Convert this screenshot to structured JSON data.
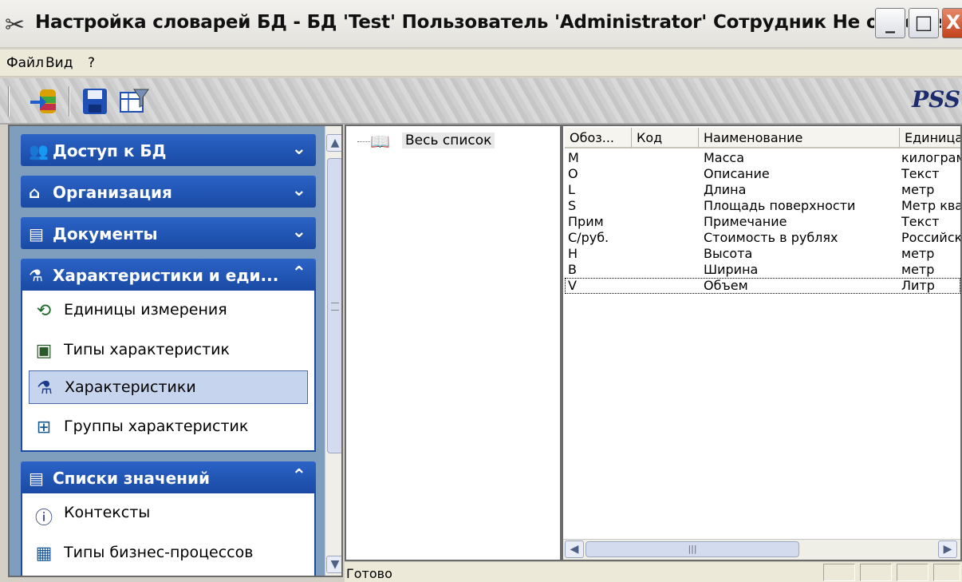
{
  "window": {
    "title": "Настройка словарей БД - БД 'Test' Пользователь 'Administrator' Сотрудник Не определен",
    "min_glyph": "_",
    "max_glyph": "□",
    "close_glyph": "X"
  },
  "menu": {
    "items": [
      "Файл",
      "Вид",
      "?"
    ]
  },
  "toolbar": {
    "logo": "PSS"
  },
  "nav": {
    "groups": [
      {
        "label": "Доступ к БД",
        "icon": "users-key-icon",
        "expanded": false
      },
      {
        "label": "Организация",
        "icon": "house-icon",
        "expanded": false
      },
      {
        "label": "Документы",
        "icon": "documents-icon",
        "expanded": false
      },
      {
        "label": "Характеристики и еди...",
        "icon": "characteristics-icon",
        "expanded": true,
        "items": [
          {
            "label": "Единицы измерения",
            "icon": "ruler-icon"
          },
          {
            "label": "Типы характеристик",
            "icon": "card-icon"
          },
          {
            "label": "Характеристики",
            "icon": "characteristics-icon",
            "selected": true
          },
          {
            "label": "Группы характеристик",
            "icon": "group-icon"
          }
        ]
      },
      {
        "label": "Списки значений",
        "icon": "lists-icon",
        "expanded": true,
        "items": [
          {
            "label": "Контексты",
            "icon": "info-icon"
          },
          {
            "label": "Типы бизнес-процессов",
            "icon": "process-icon"
          }
        ]
      }
    ]
  },
  "tree": {
    "root_label": "Весь список"
  },
  "grid": {
    "columns": [
      "Обоз...",
      "Код",
      "Наименование",
      "Единица"
    ],
    "rows": [
      [
        "M",
        "",
        "Масса",
        "килограмм"
      ],
      [
        "O",
        "",
        "Описание",
        "Текст"
      ],
      [
        "L",
        "",
        "Длина",
        "метр"
      ],
      [
        "S",
        "",
        "Площадь поверхности",
        "Метр квадратный"
      ],
      [
        "Прим",
        "",
        "Примечание",
        "Текст"
      ],
      [
        "C/руб.",
        "",
        "Стоимость в рублях",
        "Российский рубль"
      ],
      [
        "H",
        "",
        "Высота",
        "метр"
      ],
      [
        "B",
        "",
        "Ширина",
        "метр"
      ],
      [
        "V",
        "",
        "Объем",
        "Литр"
      ]
    ]
  },
  "status": {
    "text": "Готово"
  }
}
